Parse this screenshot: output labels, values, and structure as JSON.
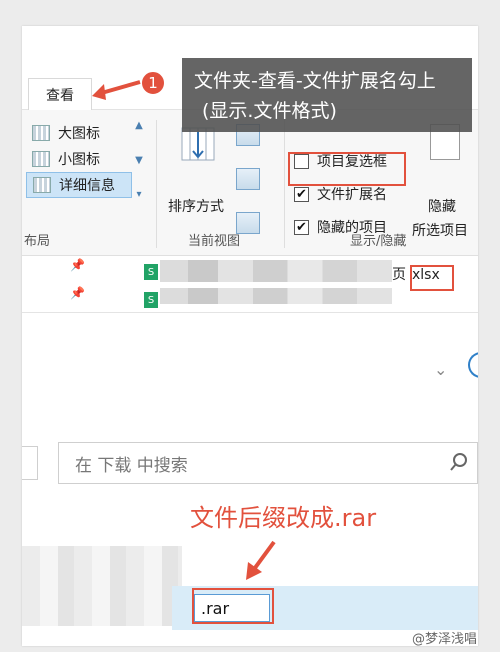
{
  "callout": {
    "badge": "1",
    "line1": "文件夹-查看-文件扩展名勾上",
    "line2": "(显示.文件格式)"
  },
  "tab": {
    "view_label": "查看"
  },
  "ribbon": {
    "layout": {
      "items": [
        "大图标",
        "小图标",
        "详细信息"
      ],
      "group_label": "布局"
    },
    "current_view": {
      "sort_label": "排序方式",
      "group_label": "当前视图"
    },
    "show_hide": {
      "item_checkbox_label": "项目复选框",
      "extension_label": "文件扩展名",
      "hidden_items_label": "隐藏的项目",
      "hide_button_label": "隐藏",
      "hide_button_sub": "所选项目",
      "group_label": "显示/隐藏",
      "item_checkbox_checked": false,
      "extension_checked": true,
      "hidden_items_checked": true
    }
  },
  "file_list": {
    "row_suffix": "页",
    "row_extension": "xlsx",
    "file_icon": "excel-file-icon"
  },
  "search": {
    "placeholder": "在 下载 中搜索",
    "icon": "search-icon"
  },
  "rename": {
    "caption": "文件后缀改成.rar",
    "value": ".rar"
  },
  "watermark": "@梦泽浅唱",
  "colors": {
    "annotation_red": "#e2513d",
    "callout_bg": "#505050",
    "selection_blue": "#cce4f7",
    "excel_green": "#21a366"
  }
}
